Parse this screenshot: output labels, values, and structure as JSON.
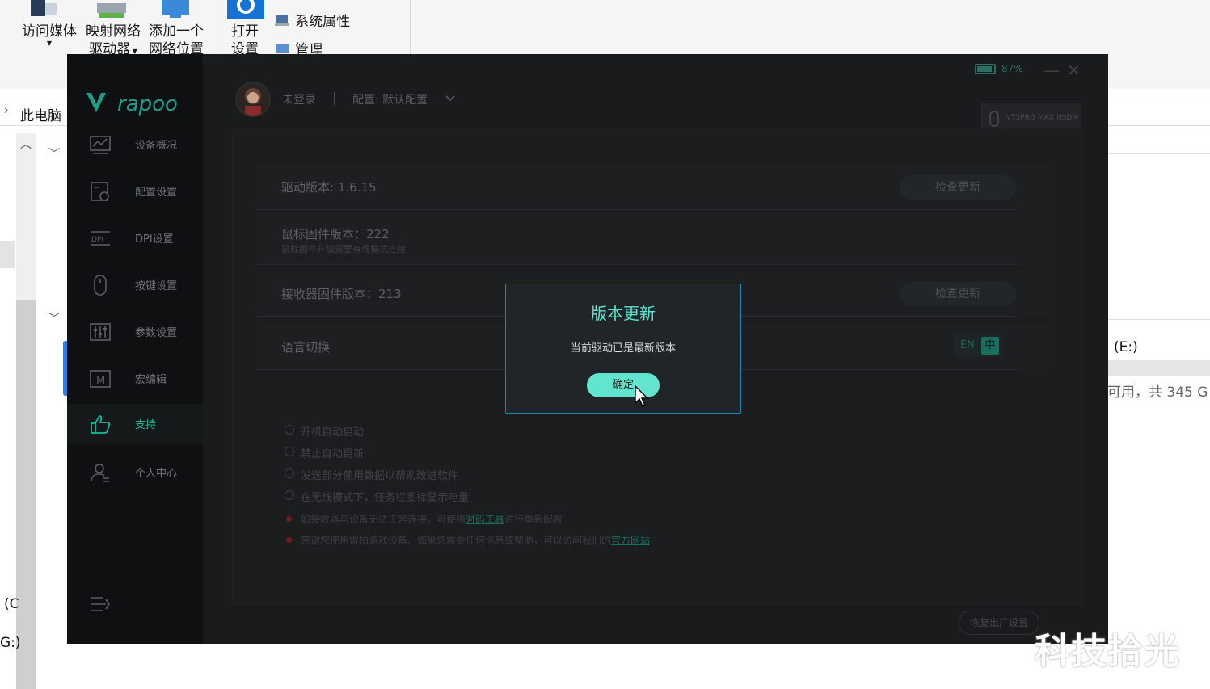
{
  "explorer": {
    "ribbon": {
      "access_media": "访问媒体",
      "map_drive_1": "映射网络",
      "map_drive_2": "驱动器",
      "add_location_1": "添加一个",
      "add_location_2": "网络位置",
      "open_settings_1": "打开",
      "open_settings_2": "设置",
      "system_properties": "系统属性",
      "manage": "管理"
    },
    "address": "此电脑",
    "drive_e": "(E:)",
    "free_space": "可用，共 345 G",
    "left_partial_1": "(C",
    "left_partial_2": "G:)"
  },
  "app": {
    "brand": "rapoo",
    "battery": "87%",
    "user_status": "未登录",
    "config": "配置: 默认配置",
    "device": "VT3PRO MAX HSDM",
    "nav": [
      {
        "label": "设备概况",
        "icon": "chart-icon"
      },
      {
        "label": "配置设置",
        "icon": "config-icon"
      },
      {
        "label": "DPI设置",
        "icon": "dpi-icon"
      },
      {
        "label": "按键设置",
        "icon": "mouse-icon"
      },
      {
        "label": "参数设置",
        "icon": "sliders-icon"
      },
      {
        "label": "宏编辑",
        "icon": "macro-icon"
      },
      {
        "label": "支持",
        "icon": "thumbs-up-icon"
      },
      {
        "label": "个人中心",
        "icon": "user-icon"
      }
    ],
    "rows": {
      "driver_version": "驱动版本: 1.6.15",
      "check_update": "检查更新",
      "mouse_fw": "鼠标固件版本：222",
      "mouse_fw_note": "鼠标固件升级需要有线模式连接",
      "receiver_fw": "接收器固件版本：213",
      "check_update_2": "检查更新",
      "language": "语言切换",
      "lang_en": "EN",
      "lang_zh": "中"
    },
    "options": [
      "开机自动启动",
      "禁止自动更新",
      "发送部分使用数据以帮助改进软件",
      "在无线模式下，任务栏图标显示电量"
    ],
    "notes": {
      "note1_pre": "如接收器与设备无法正常连接，可使用",
      "note1_link": "对码工具",
      "note1_post": "进行重新配置",
      "note2_pre": "感谢您使用雷柏游戏设备。如果您需要任何信息或帮助，可以访问我们的",
      "note2_link": "官方网站"
    },
    "reset": "恢复出厂设置"
  },
  "dialog": {
    "title": "版本更新",
    "message": "当前驱动已是最新版本",
    "ok": "确定"
  },
  "watermark": "科技拾光"
}
